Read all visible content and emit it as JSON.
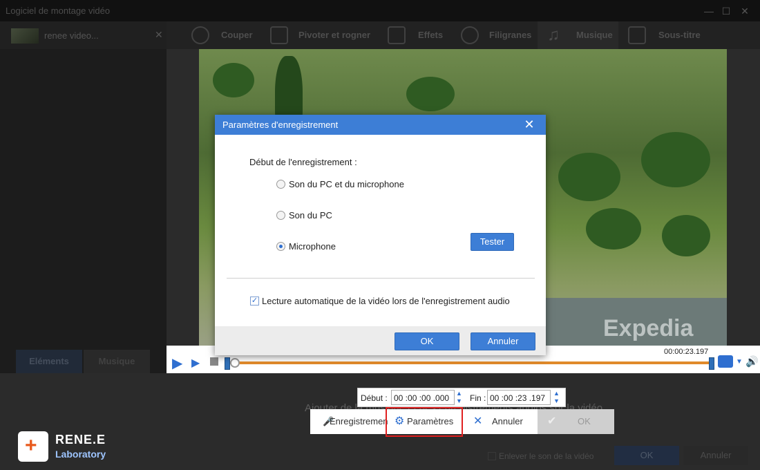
{
  "window": {
    "title": "Logiciel de montage vidéo"
  },
  "file_tab": {
    "name": "renee video..."
  },
  "toolbar": {
    "items": [
      {
        "label": "Couper",
        "icon": "scissors-icon"
      },
      {
        "label": "Pivoter et rogner",
        "icon": "crop-icon"
      },
      {
        "label": "Effets",
        "icon": "film-icon"
      },
      {
        "label": "Filigranes",
        "icon": "film-reel-icon"
      },
      {
        "label": "Musique",
        "icon": "music-note-icon",
        "active": true
      },
      {
        "label": "Sous-titre",
        "icon": "subtitle-icon"
      }
    ]
  },
  "left_tabs": {
    "elements": "Eléments",
    "music": "Musique"
  },
  "video": {
    "watermark": "Expedia"
  },
  "player": {
    "timestamp": "00:00:23.197",
    "progress": 0.0
  },
  "time_range": {
    "start_label": "Début :",
    "start_value": "00 :00 :00 .000",
    "end_label": "Fin :",
    "end_value": "00 :00 :23 .197"
  },
  "action_bar": {
    "record_label": "Enregistremen",
    "settings_label": "Paramètres",
    "cancel_label": "Annuler",
    "ok_label": "OK"
  },
  "hint_text": "Ajouter de la musique et des enregistrements audios sur la vidéo",
  "brand": {
    "line1": "RENE.E",
    "line2": "Laboratory"
  },
  "bottom": {
    "mute_label": "Enlever le son de la vidéo",
    "ok_label": "OK",
    "cancel_label": "Annuler"
  },
  "dialog": {
    "title": "Paramètres d'enregistrement",
    "section_label": "Début de l'enregistrement :",
    "options": [
      {
        "label": "Son du PC et du microphone",
        "selected": false
      },
      {
        "label": "Son du PC",
        "selected": false
      },
      {
        "label": "Microphone",
        "selected": true
      }
    ],
    "test_button": "Tester",
    "autoplay_label": "Lecture automatique de la vidéo lors de l'enregistrement audio",
    "autoplay_checked": true,
    "ok_button": "OK",
    "cancel_button": "Annuler"
  },
  "colors": {
    "accent": "#3d7ed6",
    "highlight": "#e02020",
    "timeline": "#e08a2a"
  }
}
